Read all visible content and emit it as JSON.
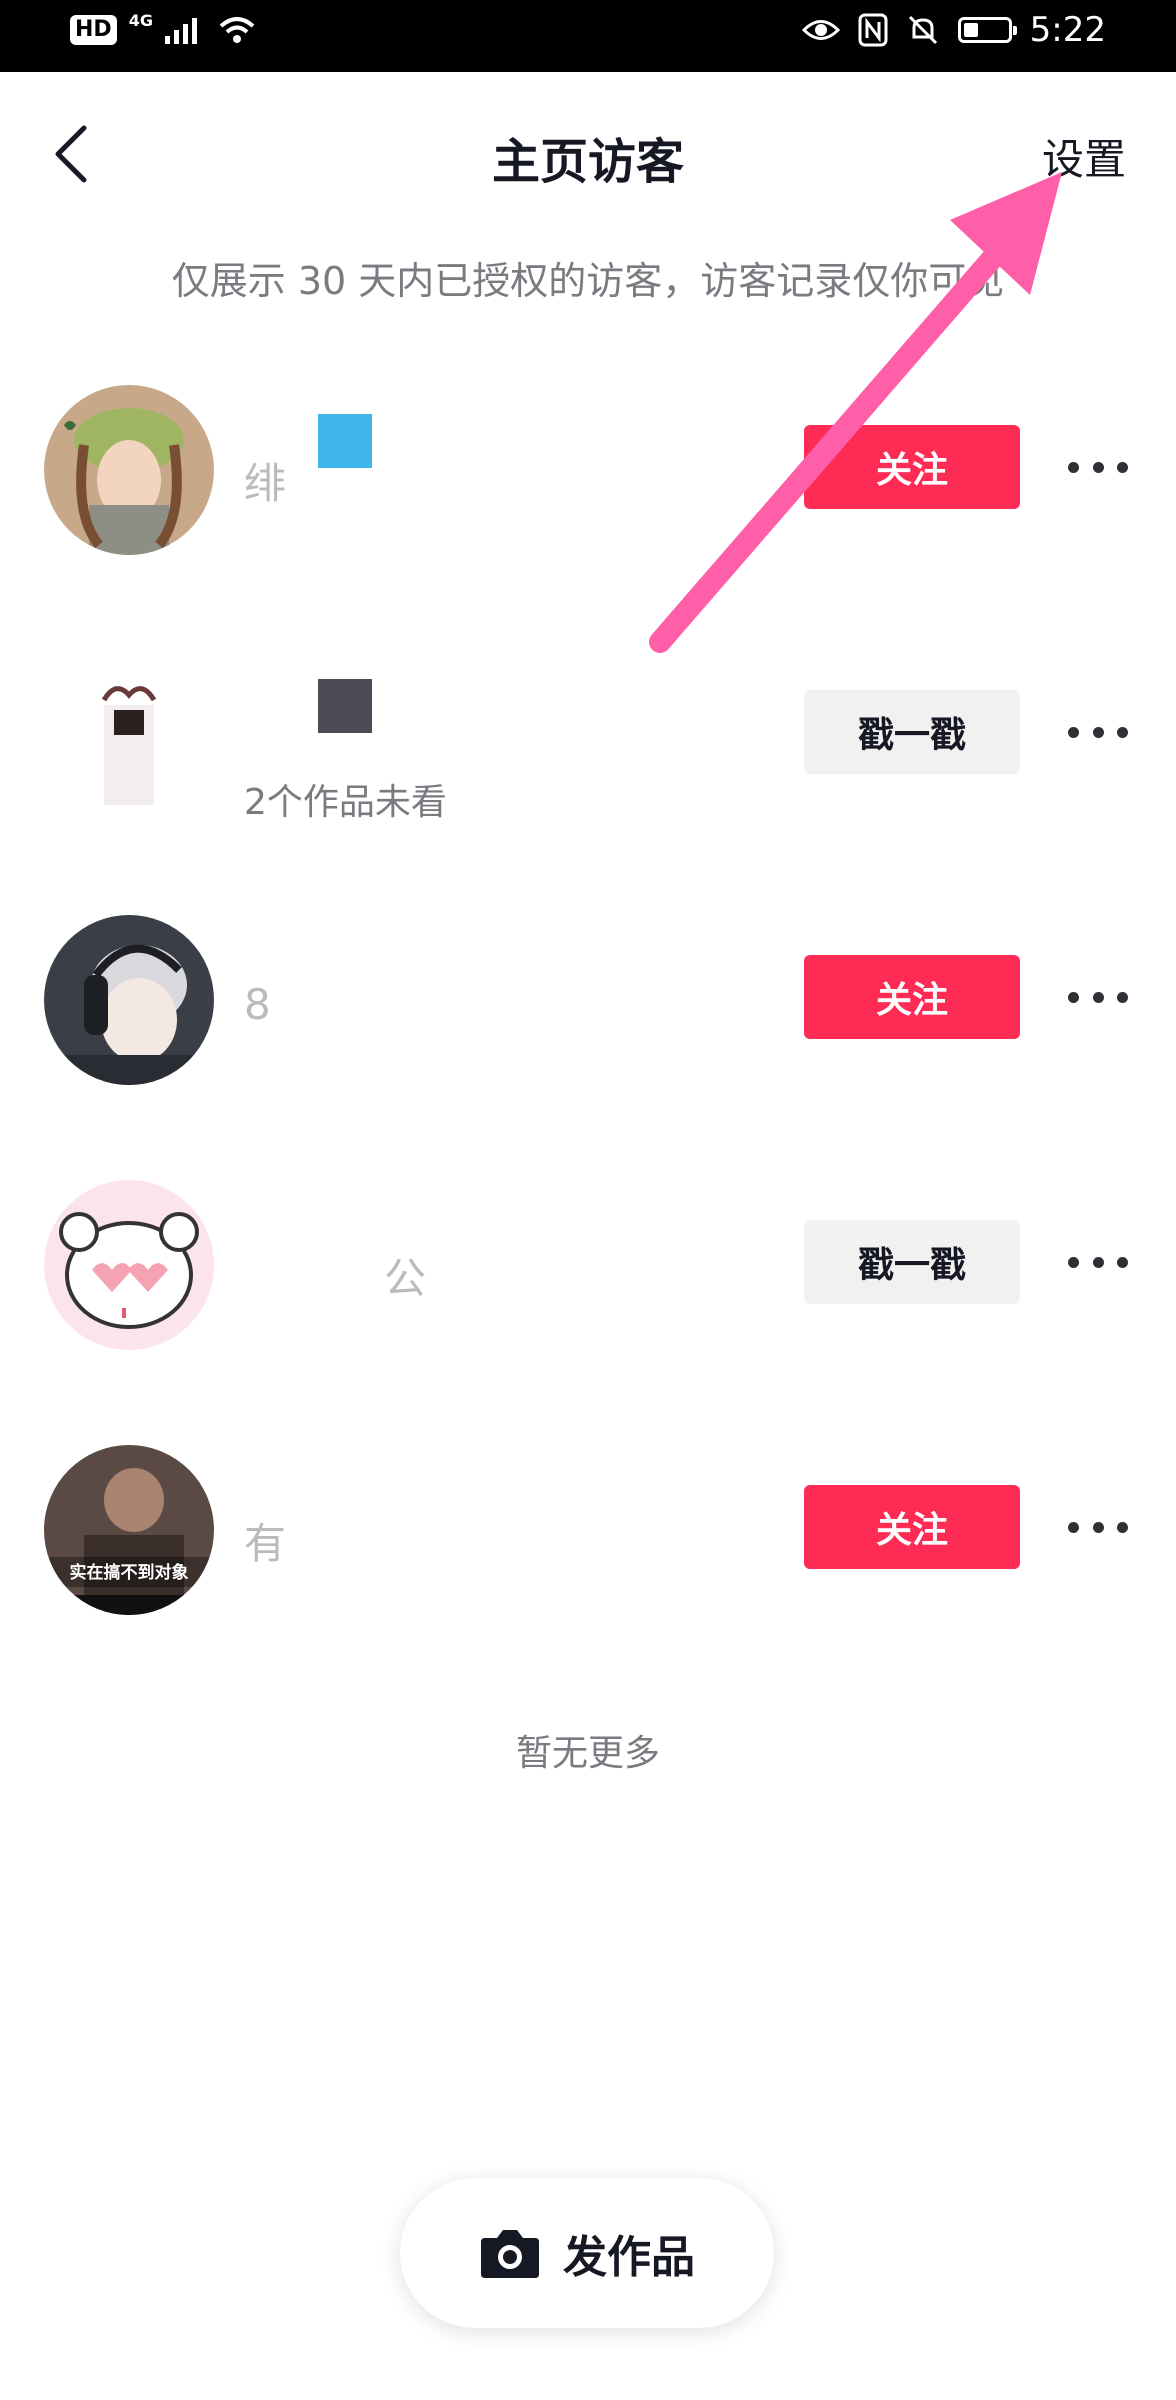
{
  "status_bar": {
    "hd_label": "HD",
    "network_label": "4G",
    "time": "5:22"
  },
  "header": {
    "title": "主页访客",
    "settings_label": "设置"
  },
  "notice": "仅展示 30 天内已授权的访客，访客记录仅你可见",
  "visitors": [
    {
      "name_partial": "绯",
      "button": "关注",
      "button_style": "follow",
      "block_color": "#3fb6e9"
    },
    {
      "name_partial": "",
      "subtitle": "2个作品未看",
      "button": "戳一戳",
      "button_style": "poke",
      "block_color": "#4c4c57"
    },
    {
      "name_partial": "8",
      "button": "关注",
      "button_style": "follow"
    },
    {
      "name_partial": "公",
      "button": "戳一戳",
      "button_style": "poke"
    },
    {
      "name_partial": "有",
      "button": "关注",
      "button_style": "follow"
    }
  ],
  "avatar_caption": "实在搞不到对象",
  "footer_text": "暂无更多",
  "post_button": {
    "label": "发作品",
    "icon": "camera-icon"
  },
  "colors": {
    "accent": "#fe2c55",
    "poke_bg": "#f1f1f2",
    "annotation_arrow": "#ff5fa8"
  }
}
